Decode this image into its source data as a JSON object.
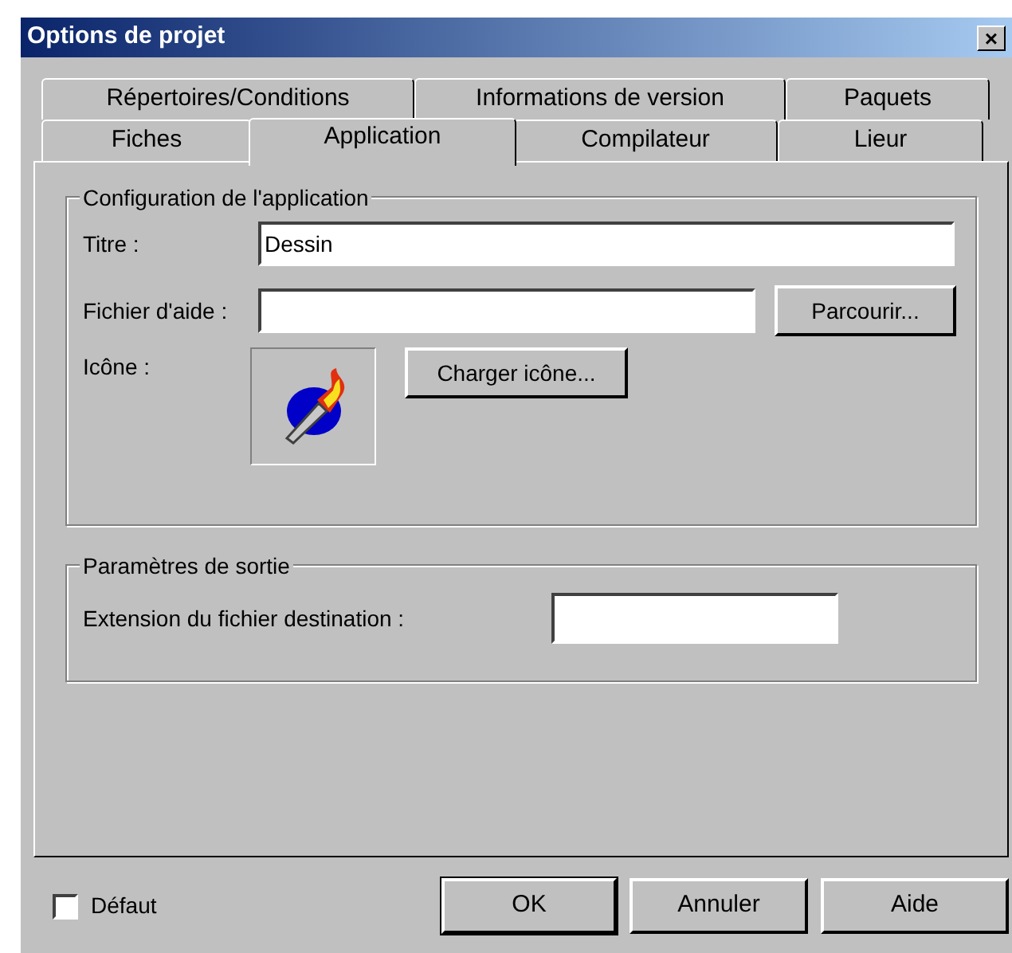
{
  "window": {
    "title": "Options de projet",
    "close": "×"
  },
  "tab_rows": [
    [
      {
        "label": "Répertoires/Conditions",
        "selected": false
      },
      {
        "label": "Informations de version",
        "selected": false
      },
      {
        "label": "Paquets",
        "selected": false
      }
    ],
    [
      {
        "label": "Fiches",
        "selected": false
      },
      {
        "label": "Application",
        "selected": true
      },
      {
        "label": "Compilateur",
        "selected": false
      },
      {
        "label": "Lieur",
        "selected": false
      }
    ]
  ],
  "app_group": {
    "title": "Configuration de l'application",
    "title_field": {
      "label": "Titre :",
      "value": "Dessin"
    },
    "help_field": {
      "label": "Fichier d'aide :"
    },
    "browse_button": "Parcourir...",
    "icon_label": "Icône :",
    "load_icon_button": "Charger icône..."
  },
  "output_group": {
    "title": "Paramètres de sortie",
    "extension_label": "Extension du fichier destination :"
  },
  "default_checkbox": {
    "label": "Défaut",
    "checked": false
  },
  "buttons": [
    {
      "label": "OK",
      "default": true
    },
    {
      "label": "Annuler",
      "default": false
    },
    {
      "label": "Aide",
      "default": false
    }
  ]
}
